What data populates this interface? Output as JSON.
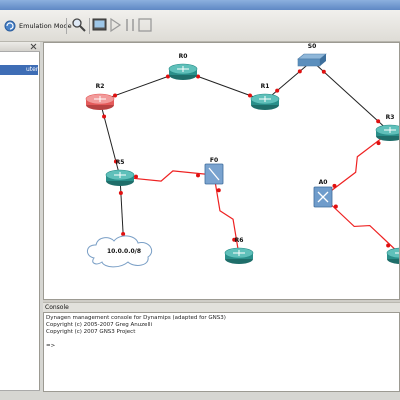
{
  "toolbar": {
    "emulation_mode_label": "Emulation Mode"
  },
  "left_panel": {
    "selected_item_label": "uter"
  },
  "topology": {
    "nodes": [
      {
        "id": "R0",
        "label": "R0",
        "kind": "router"
      },
      {
        "id": "S0",
        "label": "S0",
        "kind": "switch"
      },
      {
        "id": "R1",
        "label": "R1",
        "kind": "router"
      },
      {
        "id": "R2",
        "label": "R2",
        "kind": "router-red"
      },
      {
        "id": "R3",
        "label": "R3",
        "kind": "router"
      },
      {
        "id": "R5",
        "label": "R5",
        "kind": "router"
      },
      {
        "id": "F0",
        "label": "F0",
        "kind": "frame-relay"
      },
      {
        "id": "A0",
        "label": "A0",
        "kind": "atm-switch"
      },
      {
        "id": "R6",
        "label": "R6",
        "kind": "router"
      },
      {
        "id": "R7",
        "label": "",
        "kind": "router"
      },
      {
        "id": "C0",
        "label": "10.0.0.0/8",
        "kind": "cloud"
      }
    ],
    "links": [
      {
        "from": "R2",
        "to": "R0",
        "type": "ethernet"
      },
      {
        "from": "R0",
        "to": "R1",
        "type": "ethernet"
      },
      {
        "from": "R1",
        "to": "S0",
        "type": "ethernet"
      },
      {
        "from": "S0",
        "to": "R3",
        "type": "ethernet"
      },
      {
        "from": "R2",
        "to": "R5",
        "type": "ethernet"
      },
      {
        "from": "R5",
        "to": "C0",
        "type": "ethernet"
      },
      {
        "from": "R5",
        "to": "F0",
        "type": "serial"
      },
      {
        "from": "F0",
        "to": "R6",
        "type": "serial"
      },
      {
        "from": "R3",
        "to": "A0",
        "type": "serial"
      },
      {
        "from": "A0",
        "to": "R7",
        "type": "serial"
      }
    ]
  },
  "console": {
    "title": "Console",
    "lines": [
      "Dynagen management console for Dynamips (adapted for GNS3)",
      "Copyright (c) 2005-2007 Greg Anuzelli",
      "Copyright (c) 2007 GNS3 Project",
      "",
      "=>"
    ]
  },
  "colors": {
    "ethernet_link": "#222222",
    "serial_link": "#ee2222",
    "router_body": "#2a8f8a",
    "router_red": "#e45a5a",
    "selection": "#3e6db5"
  }
}
